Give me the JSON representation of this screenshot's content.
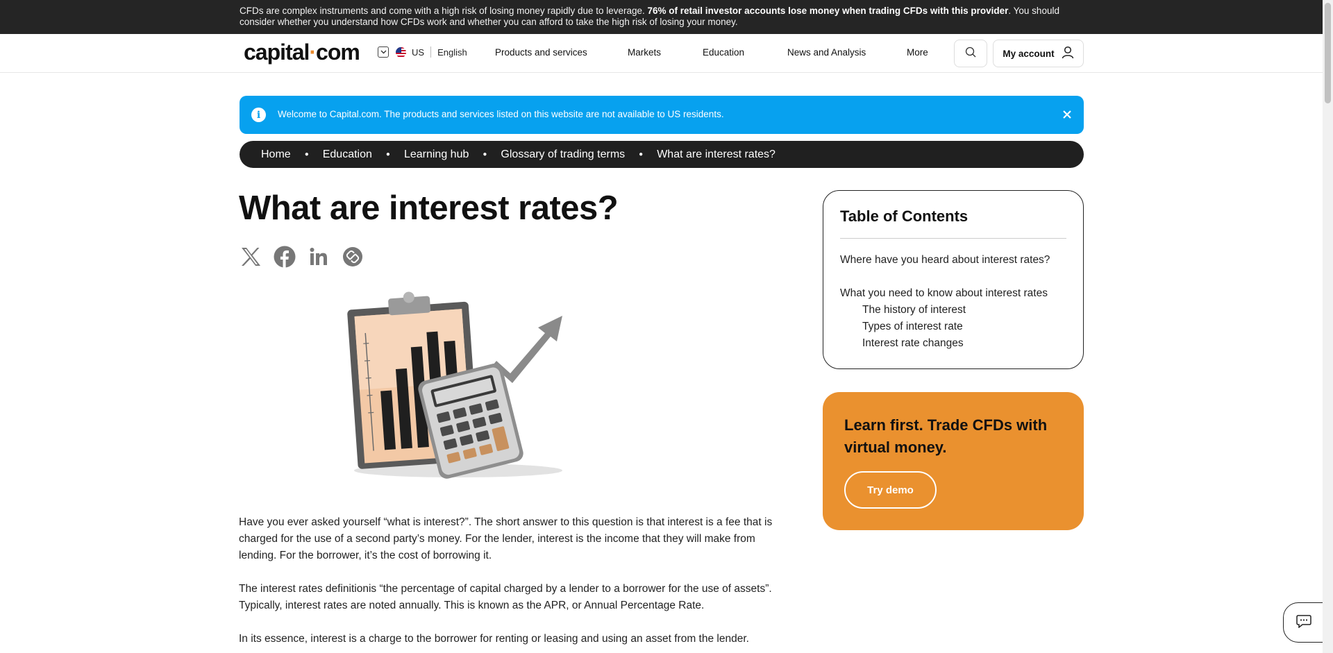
{
  "risk_banner": {
    "text_before": "CFDs are complex instruments and come with a high risk of losing money rapidly due to leverage. ",
    "bold_text": "76% of retail investor accounts lose money when trading CFDs with this provider",
    "text_after": ". You should consider whether you understand how CFDs work and whether you can afford to take the high risk of losing your money."
  },
  "header": {
    "logo_left": "capital",
    "logo_dot": "·",
    "logo_right": "com",
    "region": "US",
    "language": "English",
    "nav": [
      "Products and services",
      "Markets",
      "Education",
      "News and Analysis",
      "More"
    ],
    "account_label": "My account"
  },
  "notice": {
    "message": "Welcome to Capital.com. The products and services listed on this website are not available to US residents."
  },
  "breadcrumb": [
    "Home",
    "Education",
    "Learning hub",
    "Glossary of trading terms",
    "What are interest rates?"
  ],
  "article": {
    "title": "What are interest rates?",
    "paragraphs": [
      "Have you ever asked yourself “what is interest?”. The short answer to this question is that interest is a fee that is charged for the use of a second party’s money. For the lender, interest is the income that they will make from lending. For the borrower, it’s the cost of borrowing it.",
      "The interest rates definitionis “the percentage of capital charged by a lender to a borrower for the use of assets”. Typically, interest rates are noted annually. This is known as the APR, or Annual Percentage Rate.",
      "In its essence, interest is a charge to the borrower for renting or leasing and using an asset from the lender."
    ]
  },
  "toc": {
    "title": "Table of Contents",
    "items": [
      "Where have you heard about interest rates?",
      "What you need to know about interest rates",
      "The history of interest",
      "Types of interest rate",
      "Interest rate changes"
    ]
  },
  "demo_card": {
    "heading": "Learn first. Trade CFDs with virtual money.",
    "button": "Try demo"
  },
  "colors": {
    "accent_orange": "#ea912f",
    "notice_blue": "#07a1ef",
    "dark": "#202020"
  },
  "icons": [
    "x-icon",
    "facebook-icon",
    "linkedin-icon",
    "link-icon",
    "search-icon",
    "user-icon",
    "info-icon",
    "close-icon",
    "chat-icon"
  ]
}
